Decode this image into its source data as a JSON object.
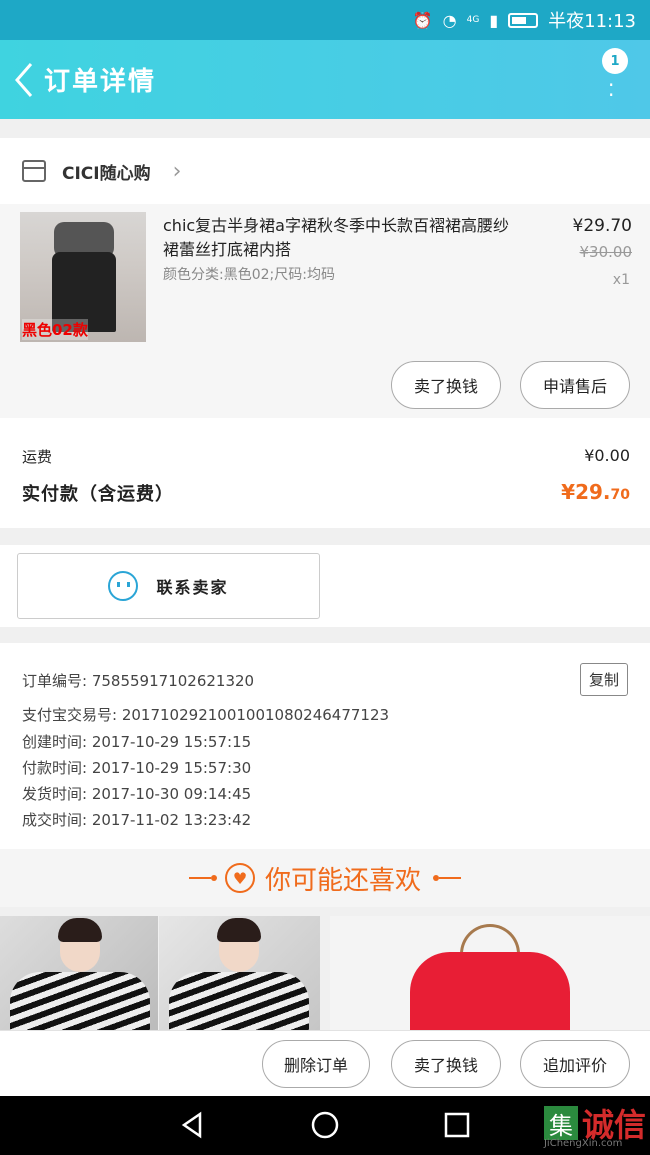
{
  "status_bar": {
    "network": "4G",
    "time": "半夜11:13"
  },
  "header": {
    "title": "订单详情",
    "badge_count": "1"
  },
  "shop": {
    "name": "CICI随心购"
  },
  "product": {
    "title": "chic复古半身裙a字裙秋冬季中长款百褶裙高腰纱裙蕾丝打底裙内搭",
    "spec": "颜色分类:黑色02;尺码:均码",
    "price": "¥29.70",
    "original_price": "¥30.00",
    "quantity": "x1",
    "image_tag": "黑色02款",
    "buttons": {
      "exchange": "卖了换钱",
      "after_sale": "申请售后"
    }
  },
  "fees": {
    "shipping_label": "运费",
    "shipping_value": "¥0.00",
    "paid_label": "实付款（含运费）",
    "paid_value_main": "¥29.",
    "paid_value_decimal": "70"
  },
  "contact": {
    "label": "联系卖家"
  },
  "order_info": {
    "order_no_label": "订单编号:",
    "order_no": "75855917102621320",
    "copy_label": "复制",
    "alipay_label": "支付宝交易号:",
    "alipay_no": "2017102921001001080246477123",
    "created_label": "创建时间:",
    "created": "2017-10-29 15:57:15",
    "paid_label": "付款时间:",
    "paid": "2017-10-29 15:57:30",
    "shipped_label": "发货时间:",
    "shipped": "2017-10-30 09:14:45",
    "completed_label": "成交时间:",
    "completed": "2017-11-02 13:23:42"
  },
  "recommend": {
    "title": "你可能还喜欢"
  },
  "action_bar": {
    "delete": "删除订单",
    "exchange": "卖了换钱",
    "review": "追加评价"
  },
  "watermark": {
    "logo": "集",
    "text": "诚信",
    "sub": "JiChengXin.com"
  },
  "colors": {
    "header": "#3fd3e0",
    "accent_price": "#f06b1c",
    "contact_icon": "#2aa5d6"
  },
  "icons": [
    "alarm-icon",
    "wifi-icon",
    "signal-icon",
    "battery-icon",
    "back-arrow-icon",
    "more-icon",
    "store-icon",
    "chevron-right-icon",
    "contact-face-icon",
    "heart-icon",
    "nav-back-icon",
    "nav-home-icon",
    "nav-recent-icon"
  ]
}
